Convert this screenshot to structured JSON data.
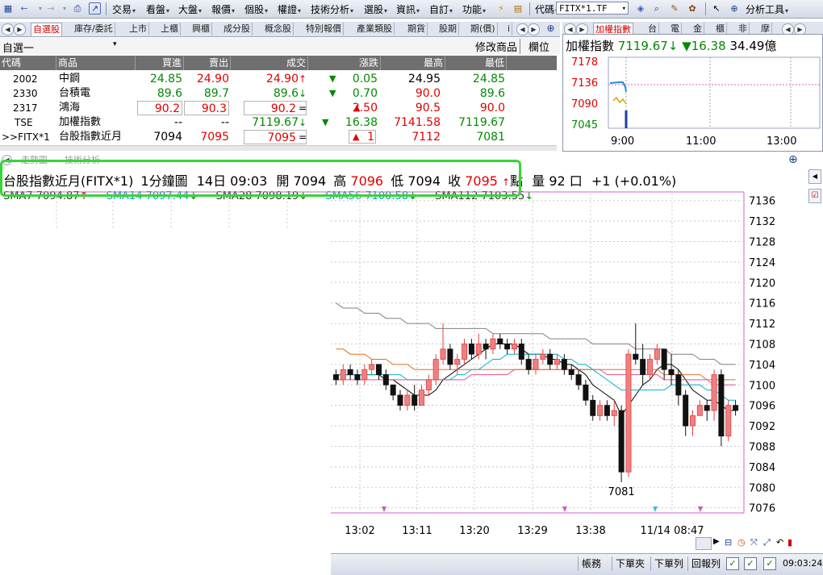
{
  "toolbar": {
    "menus": [
      "交易",
      "看盤",
      "大盤",
      "報價",
      "個股",
      "權證",
      "技術分析",
      "選股",
      "資訊",
      "自訂",
      "功能"
    ],
    "code_label": "代碼",
    "code_value": "FITX*1.TF",
    "analysis_tools": "分析工具"
  },
  "watch_tabs": [
    "自選股",
    "庫存/委託",
    "上市",
    "上櫃",
    "興櫃",
    "成分股",
    "概念股",
    "特別報價",
    "產業類股",
    "期貨",
    "股期",
    "期(價)",
    "i"
  ],
  "index_tabs": [
    "加權指數",
    "台",
    "電",
    "金",
    "櫃",
    "非",
    "摩"
  ],
  "watchlist": {
    "group_name": "自選一",
    "modify_label": "修改商品",
    "columns_label": "欄位",
    "headers": [
      "代碼",
      "商品",
      "買進",
      "賣出",
      "成交",
      "漲跌",
      "最高",
      "最低"
    ],
    "rows": [
      {
        "code": "2002",
        "name": "中鋼",
        "bid": "24.85",
        "ask": "24.90",
        "last": "24.90",
        "last_mark": "↑",
        "change": "0.05",
        "change_mark": "▼",
        "high": "24.95",
        "low": "24.85"
      },
      {
        "code": "2330",
        "name": "台積電",
        "bid": "89.6",
        "ask": "89.7",
        "last": "89.6",
        "last_mark": "↓",
        "change": "0.70",
        "change_mark": "▼",
        "high": "90.0",
        "low": "89.6"
      },
      {
        "code": "2317",
        "name": "鴻海",
        "bid": "90.2",
        "ask": "90.3",
        "last": "90.2",
        "last_mark": "=",
        "change": "2.50",
        "change_mark": "▲",
        "high": "90.5",
        "low": "90.0"
      },
      {
        "code": "TSE",
        "name": "加權指數",
        "bid": "--",
        "ask": "--",
        "last": "7119.67",
        "last_mark": "↓",
        "change": "16.38",
        "change_mark": "▼",
        "high": "7141.58",
        "low": "7119.67"
      },
      {
        "code": ">>FITX*1",
        "name": "台股指數近月",
        "bid": "7094",
        "ask": "7095",
        "last": "7095",
        "last_mark": "=",
        "change": "1",
        "change_mark": "▲",
        "high": "7112",
        "low": "7081"
      }
    ]
  },
  "index_panel": {
    "name": "加權指數",
    "value": "7119.67",
    "value_mark": "↓",
    "change": "16.38",
    "change_mark": "▼",
    "volume": "34.49億",
    "y_ticks": [
      "7178",
      "7136",
      "7090",
      "7045"
    ],
    "x_ticks": [
      "9:00",
      "11:00",
      "13:00"
    ]
  },
  "chart_tabs": [
    "走勢圖",
    "技術分析"
  ],
  "chart_header": {
    "product": "台股指數近月(FITX*1)",
    "period": "1分鐘圖",
    "date_time": "14日 09:03",
    "open_label": "開",
    "open": "7094",
    "high_label": "高",
    "high": "7096",
    "low_label": "低",
    "low": "7094",
    "close_label": "收",
    "close": "7095",
    "close_mark": "↑",
    "unit": "點",
    "vol_label": "量",
    "vol": "92",
    "vol_unit": "口",
    "diff": "+1 (+0.01%)"
  },
  "ma_legend": [
    {
      "label": "SMA7",
      "value": "7094.87",
      "mark": "↑",
      "color": "#000000"
    },
    {
      "label": "SMA14",
      "value": "7097.44",
      "mark": "↓",
      "color": "#00b0d0"
    },
    {
      "label": "SMA28",
      "value": "7098.19",
      "mark": "↓",
      "color": "#000000"
    },
    {
      "label": "SMA56",
      "value": "7100.58",
      "mark": "↓",
      "color": "#00b0d0"
    },
    {
      "label": "SMA112",
      "value": "7103.55",
      "mark": "↓",
      "color": "#000000"
    }
  ],
  "chart_data": {
    "type": "candlestick",
    "y_ticks": [
      7136,
      7132,
      7128,
      7124,
      7120,
      7116,
      7112,
      7108,
      7104,
      7100,
      7096,
      7092,
      7088,
      7084,
      7080,
      7076
    ],
    "ylim": [
      7075,
      7138
    ],
    "x_ticks": [
      "13:02",
      "13:11",
      "13:20",
      "13:29",
      "13:38",
      "11/14 08:47"
    ],
    "annotation": "7081",
    "candles": [
      [
        7102,
        7103,
        7100,
        7101
      ],
      [
        7101,
        7104,
        7100,
        7103
      ],
      [
        7103,
        7104,
        7101,
        7102
      ],
      [
        7102,
        7103,
        7100,
        7101
      ],
      [
        7101,
        7104,
        7100,
        7103
      ],
      [
        7103,
        7105,
        7102,
        7104
      ],
      [
        7104,
        7104,
        7101,
        7102
      ],
      [
        7102,
        7103,
        7099,
        7100
      ],
      [
        7100,
        7100,
        7097,
        7098
      ],
      [
        7098,
        7099,
        7095,
        7096
      ],
      [
        7096,
        7099,
        7095,
        7098
      ],
      [
        7098,
        7100,
        7095,
        7096
      ],
      [
        7096,
        7100,
        7096,
        7099
      ],
      [
        7099,
        7102,
        7098,
        7101
      ],
      [
        7101,
        7106,
        7100,
        7105
      ],
      [
        7105,
        7112,
        7104,
        7107
      ],
      [
        7107,
        7108,
        7103,
        7104
      ],
      [
        7104,
        7106,
        7102,
        7105
      ],
      [
        7105,
        7109,
        7104,
        7108
      ],
      [
        7108,
        7109,
        7105,
        7106
      ],
      [
        7106,
        7110,
        7105,
        7108
      ],
      [
        7108,
        7109,
        7105,
        7107
      ],
      [
        7107,
        7110,
        7106,
        7109
      ],
      [
        7109,
        7110,
        7107,
        7108
      ],
      [
        7108,
        7109,
        7106,
        7107
      ],
      [
        7107,
        7109,
        7106,
        7108
      ],
      [
        7108,
        7109,
        7104,
        7105
      ],
      [
        7105,
        7106,
        7102,
        7103
      ],
      [
        7103,
        7106,
        7102,
        7105
      ],
      [
        7105,
        7107,
        7104,
        7106
      ],
      [
        7106,
        7107,
        7103,
        7104
      ],
      [
        7104,
        7106,
        7103,
        7105
      ],
      [
        7105,
        7106,
        7102,
        7103
      ],
      [
        7103,
        7104,
        7101,
        7102
      ],
      [
        7102,
        7103,
        7099,
        7100
      ],
      [
        7100,
        7101,
        7096,
        7097
      ],
      [
        7097,
        7098,
        7093,
        7094
      ],
      [
        7094,
        7097,
        7093,
        7096
      ],
      [
        7096,
        7097,
        7093,
        7094
      ],
      [
        7094,
        7097,
        7092,
        7095
      ],
      [
        7095,
        7096,
        7081,
        7083
      ],
      [
        7083,
        7107,
        7082,
        7106
      ],
      [
        7106,
        7112,
        7104,
        7105
      ],
      [
        7105,
        7108,
        7100,
        7102
      ],
      [
        7102,
        7106,
        7101,
        7105
      ],
      [
        7105,
        7108,
        7104,
        7107
      ],
      [
        7107,
        7107,
        7101,
        7103
      ],
      [
        7103,
        7106,
        7100,
        7102
      ],
      [
        7102,
        7103,
        7096,
        7098
      ],
      [
        7098,
        7099,
        7090,
        7092
      ],
      [
        7092,
        7095,
        7090,
        7094
      ],
      [
        7094,
        7097,
        7094,
        7096
      ],
      [
        7096,
        7097,
        7093,
        7095
      ],
      [
        7095,
        7103,
        7093,
        7102
      ],
      [
        7102,
        7103,
        7088,
        7090
      ],
      [
        7090,
        7097,
        7089,
        7096
      ],
      [
        7096,
        7097,
        7094,
        7095
      ]
    ],
    "sma_series": [
      {
        "label": "SMA7",
        "color": "#000000",
        "values": [
          7102,
          7102,
          7102,
          7102,
          7102,
          7102,
          7102,
          7101,
          7101,
          7100,
          7099,
          7098,
          7098,
          7098,
          7099,
          7101,
          7102,
          7103,
          7104,
          7105,
          7106,
          7107,
          7108,
          7108,
          7108,
          7108,
          7107,
          7106,
          7106,
          7106,
          7105,
          7105,
          7104,
          7104,
          7103,
          7102,
          7100,
          7099,
          7098,
          7097,
          7094,
          7096,
          7098,
          7100,
          7101,
          7103,
          7104,
          7104,
          7103,
          7101,
          7099,
          7098,
          7097,
          7097,
          7096,
          7095,
          7095
        ]
      },
      {
        "label": "SMA14",
        "color": "#00b0d0",
        "values": [
          7102,
          7102,
          7102,
          7102,
          7102,
          7102,
          7102,
          7102,
          7102,
          7102,
          7101,
          7101,
          7101,
          7101,
          7101,
          7101,
          7101,
          7102,
          7102,
          7103,
          7103,
          7104,
          7105,
          7105,
          7106,
          7106,
          7106,
          7106,
          7106,
          7106,
          7106,
          7106,
          7105,
          7105,
          7104,
          7104,
          7103,
          7102,
          7101,
          7100,
          7099,
          7099,
          7099,
          7099,
          7099,
          7099,
          7099,
          7100,
          7100,
          7100,
          7100,
          7100,
          7099,
          7099,
          7098,
          7097,
          7097
        ]
      },
      {
        "label": "SMA28",
        "color": "#e05090",
        "values": [
          7101,
          7101,
          7101,
          7101,
          7101,
          7101,
          7101,
          7101,
          7101,
          7101,
          7101,
          7101,
          7101,
          7101,
          7101,
          7101,
          7101,
          7101,
          7101,
          7102,
          7102,
          7102,
          7102,
          7102,
          7102,
          7103,
          7103,
          7103,
          7103,
          7103,
          7103,
          7103,
          7103,
          7103,
          7103,
          7103,
          7103,
          7103,
          7102,
          7102,
          7102,
          7102,
          7102,
          7102,
          7102,
          7102,
          7101,
          7101,
          7101,
          7101,
          7101,
          7101,
          7101,
          7100,
          7100,
          7100,
          7100
        ]
      },
      {
        "label": "SMA56",
        "color": "#e07020",
        "values": [
          7107,
          7107,
          7106,
          7106,
          7106,
          7105,
          7105,
          7105,
          7104,
          7104,
          7104,
          7103,
          7103,
          7103,
          7103,
          7103,
          7103,
          7103,
          7103,
          7103,
          7103,
          7103,
          7103,
          7103,
          7103,
          7103,
          7103,
          7103,
          7103,
          7103,
          7103,
          7103,
          7103,
          7103,
          7103,
          7103,
          7103,
          7103,
          7103,
          7103,
          7103,
          7103,
          7103,
          7103,
          7103,
          7103,
          7102,
          7102,
          7102,
          7102,
          7102,
          7102,
          7101,
          7101,
          7101,
          7101,
          7101
        ]
      },
      {
        "label": "SMA112",
        "color": "#808080",
        "values": [
          7116,
          7115,
          7115,
          7115,
          7114,
          7114,
          7114,
          7113,
          7113,
          7113,
          7112,
          7112,
          7112,
          7112,
          7111,
          7111,
          7111,
          7111,
          7111,
          7111,
          7111,
          7111,
          7110,
          7110,
          7110,
          7110,
          7110,
          7110,
          7110,
          7110,
          7109,
          7109,
          7109,
          7109,
          7109,
          7109,
          7108,
          7108,
          7108,
          7108,
          7108,
          7108,
          7107,
          7107,
          7107,
          7107,
          7107,
          7106,
          7106,
          7106,
          7106,
          7105,
          7105,
          7105,
          7104,
          7104,
          7104
        ]
      }
    ]
  },
  "bottom_bar": {
    "buttons": [
      "帳務",
      "下單夾",
      "下單列",
      "回報列"
    ],
    "clock": "09:03:24"
  },
  "colors": {
    "up": "#e00000",
    "down": "#008a00",
    "highlight": "#35d635"
  }
}
